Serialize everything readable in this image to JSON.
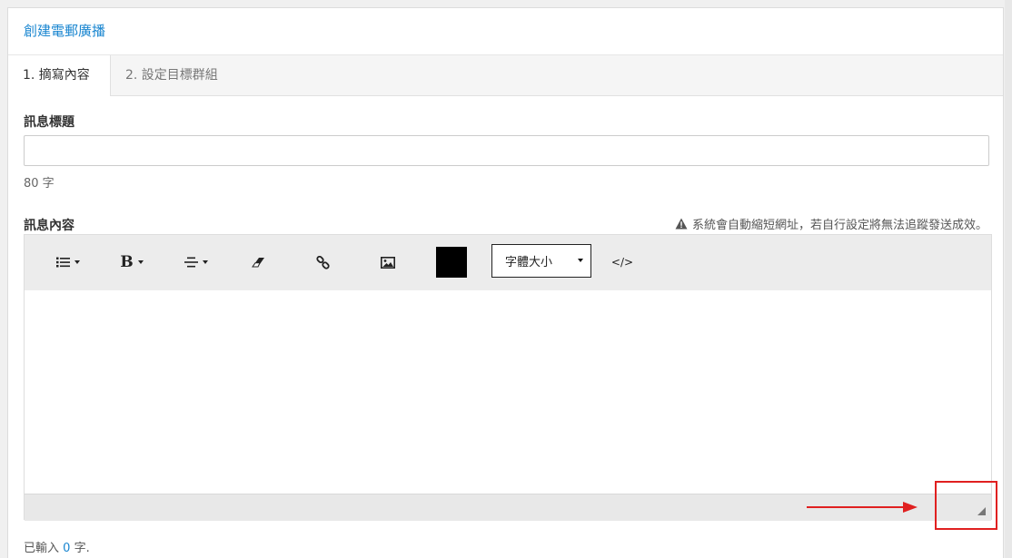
{
  "panel": {
    "title": "創建電郵廣播"
  },
  "tabs": [
    {
      "label": "1. 摘寫內容",
      "active": true
    },
    {
      "label": "2. 設定目標群組",
      "active": false
    }
  ],
  "subject": {
    "label": "訊息標題",
    "value": "",
    "placeholder": "",
    "limit_text": "80 字"
  },
  "content": {
    "label": "訊息內容",
    "warning": "系統會自動縮短網址，若自行設定將無法追蹤發送成效。",
    "warning_icon": "warning-triangle-icon"
  },
  "toolbar": {
    "buttons": [
      {
        "name": "list-dropdown-button",
        "icon": "list-icon"
      },
      {
        "name": "bold-dropdown-button",
        "icon": "bold-icon",
        "glyph": "B"
      },
      {
        "name": "align-dropdown-button",
        "icon": "align-center-icon"
      },
      {
        "name": "clear-format-button",
        "icon": "eraser-icon"
      },
      {
        "name": "link-button",
        "icon": "link-icon"
      },
      {
        "name": "image-button",
        "icon": "image-icon"
      },
      {
        "name": "code-view-button",
        "icon": "code-icon",
        "glyph": "</>"
      }
    ],
    "text_color": "#000000",
    "font_size_label": "字體大小"
  },
  "char_count": {
    "prefix": "已輸入",
    "value": "0",
    "suffix": "字."
  },
  "colors": {
    "accent": "#1a86d0",
    "annotation": "#e02020"
  }
}
